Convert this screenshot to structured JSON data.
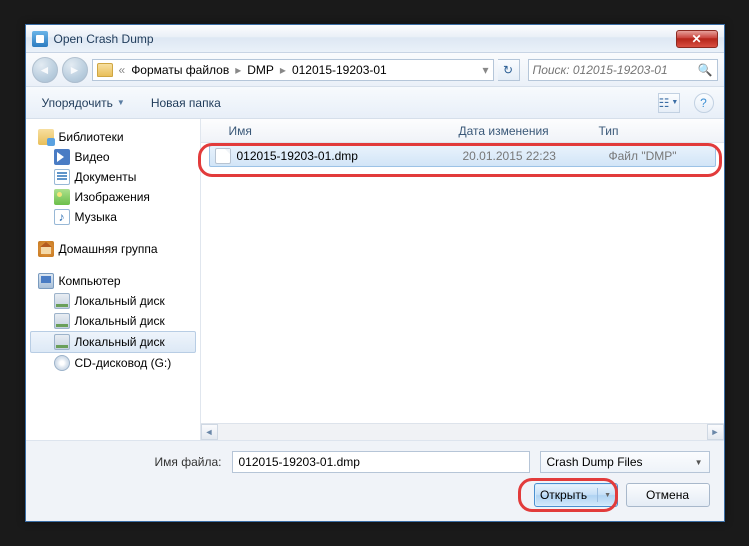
{
  "window": {
    "title": "Open Crash Dump"
  },
  "breadcrumb": {
    "items": [
      "Форматы файлов",
      "DMP",
      "012015-19203-01"
    ]
  },
  "search": {
    "placeholder": "Поиск: 012015-19203-01"
  },
  "toolbar": {
    "organize": "Упорядочить",
    "newfolder": "Новая папка"
  },
  "sidebar": {
    "libraries": "Библиотеки",
    "video": "Видео",
    "documents": "Документы",
    "pictures": "Изображения",
    "music": "Музыка",
    "homegroup": "Домашняя группа",
    "computer": "Компьютер",
    "disk1": "Локальный диск",
    "disk2": "Локальный диск",
    "disk3": "Локальный диск",
    "cd": "CD-дисковод (G:)"
  },
  "columns": {
    "name": "Имя",
    "date": "Дата изменения",
    "type": "Тип"
  },
  "file": {
    "name": "012015-19203-01.dmp",
    "date": "20.01.2015 22:23",
    "type": "Файл \"DMP\""
  },
  "footer": {
    "filelabel": "Имя файла:",
    "filevalue": "012015-19203-01.dmp",
    "filter": "Crash Dump Files",
    "open": "Открыть",
    "cancel": "Отмена"
  }
}
